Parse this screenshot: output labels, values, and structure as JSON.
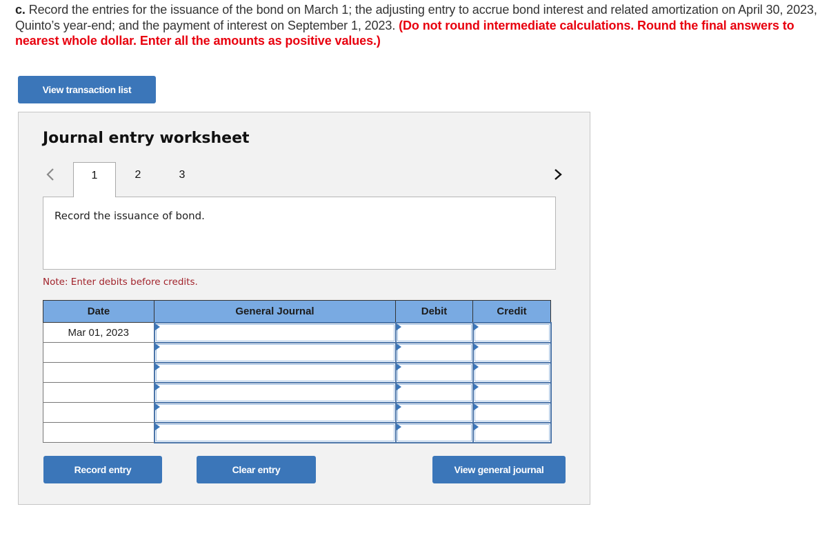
{
  "instructions": {
    "label": "c.",
    "text": " Record the entries for the issuance of the bond on March 1; the adjusting entry to accrue bond interest and related amortization on April 30, 2023, Quinto’s year-end; and the payment of interest on September 1, 2023. ",
    "emphasis": "(Do not round intermediate calculations. Round the final answers to nearest whole dollar. Enter all the amounts as positive values.)"
  },
  "view_transaction_list_label": "View transaction list",
  "worksheet": {
    "title": "Journal entry worksheet",
    "prev_icon": "chevron-left-icon",
    "next_icon": "chevron-right-icon",
    "tabs": [
      {
        "label": "1",
        "active": true
      },
      {
        "label": "2",
        "active": false
      },
      {
        "label": "3",
        "active": false
      }
    ],
    "description": "Record the issuance of bond.",
    "note": "Note: Enter debits before credits.",
    "table": {
      "headers": [
        "Date",
        "General Journal",
        "Debit",
        "Credit"
      ],
      "rows": [
        {
          "date": "Mar 01, 2023",
          "account": "",
          "debit": "",
          "credit": ""
        },
        {
          "date": "",
          "account": "",
          "debit": "",
          "credit": ""
        },
        {
          "date": "",
          "account": "",
          "debit": "",
          "credit": ""
        },
        {
          "date": "",
          "account": "",
          "debit": "",
          "credit": ""
        },
        {
          "date": "",
          "account": "",
          "debit": "",
          "credit": ""
        },
        {
          "date": "",
          "account": "",
          "debit": "",
          "credit": ""
        }
      ]
    },
    "buttons": {
      "record": "Record entry",
      "clear": "Clear entry",
      "view_general_journal": "View general journal"
    }
  },
  "colors": {
    "button_blue": "#3b76b9",
    "header_blue": "#79aae2",
    "emphasis_red": "#e8000e",
    "note_red": "#a1222a"
  }
}
